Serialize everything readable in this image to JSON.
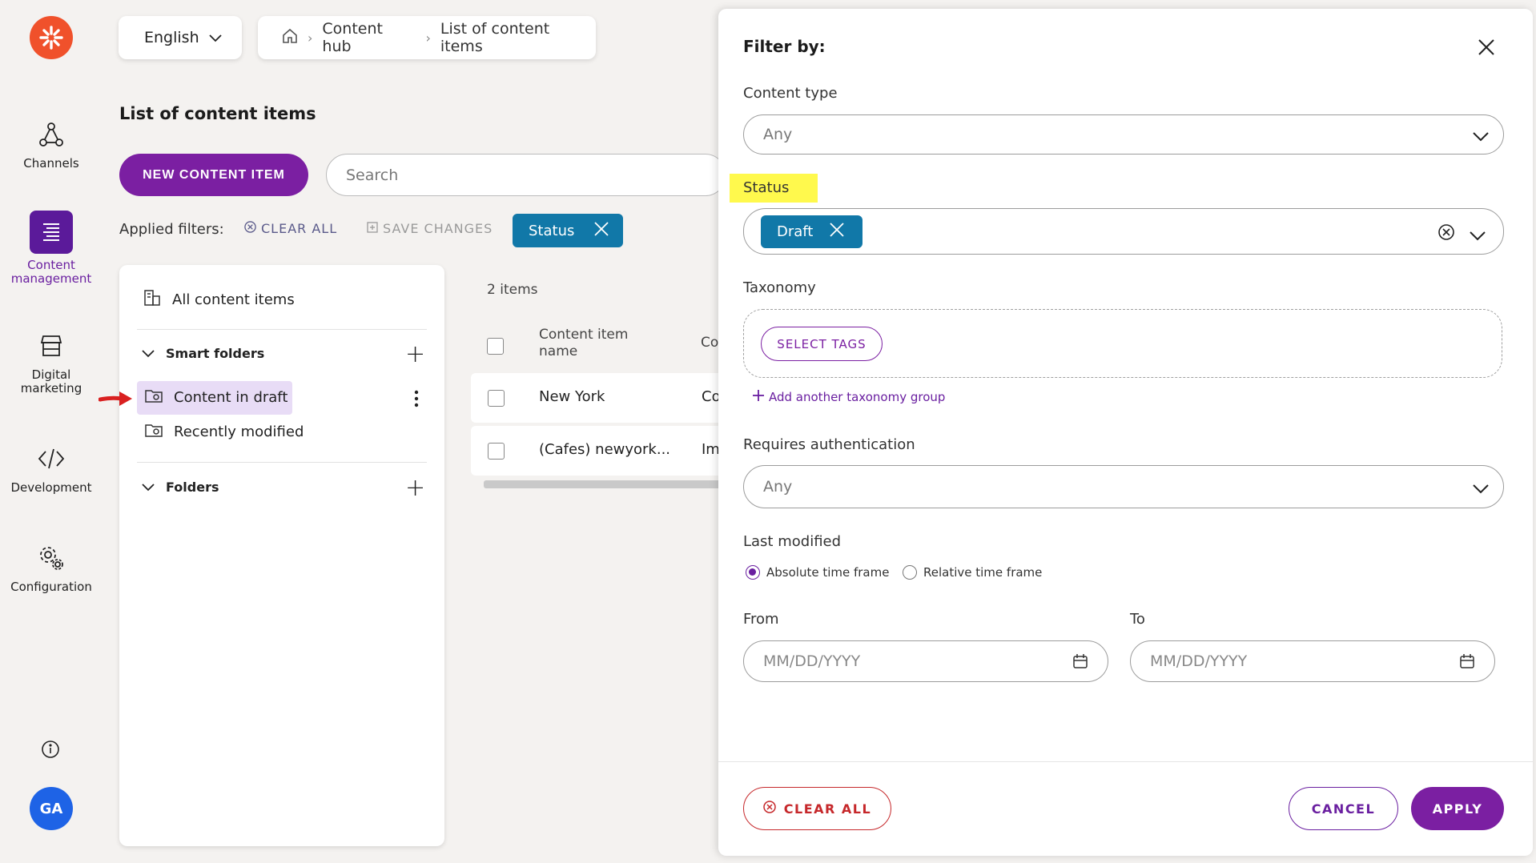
{
  "colors": {
    "brand": "#f0512b",
    "primary": "#7b1fa2",
    "chip": "#1178a8",
    "danger": "#c6282b",
    "highlight": "#fff94d",
    "avatar": "#1e63e6"
  },
  "nav": {
    "logo_icon": "asterisk-logo-icon",
    "items": [
      {
        "label": "Channels",
        "icon": "channels-icon"
      },
      {
        "label": "Content management",
        "icon": "content-management-icon"
      },
      {
        "label": "Digital marketing",
        "icon": "storefront-icon"
      },
      {
        "label": "Development",
        "icon": "code-icon"
      },
      {
        "label": "Configuration",
        "icon": "gear-icon"
      }
    ],
    "info_icon": "info-icon",
    "avatar_initials": "GA"
  },
  "topbar": {
    "language": "English",
    "breadcrumb": [
      "Content hub",
      "List of content items"
    ]
  },
  "main": {
    "title": "List of content items",
    "new_button": "NEW CONTENT ITEM",
    "search_placeholder": "Search",
    "applied_filters_label": "Applied filters:",
    "clear_all": "CLEAR ALL",
    "save_changes": "SAVE CHANGES",
    "status_chip": "Status"
  },
  "folders": {
    "all_items": "All content items",
    "smart_folders_label": "Smart folders",
    "smart_folders": [
      "Content in draft",
      "Recently modified"
    ],
    "folders_label": "Folders"
  },
  "list": {
    "count": "2 items",
    "header_name": "Content item name",
    "header_second": "Co",
    "rows": [
      {
        "name": "New York",
        "second": "Co"
      },
      {
        "name": "(Cafes) newyork...",
        "second": "Im"
      }
    ]
  },
  "filter": {
    "title": "Filter by:",
    "content_type_label": "Content type",
    "content_type_value": "Any",
    "status_label": "Status",
    "status_chip": "Draft",
    "taxonomy_label": "Taxonomy",
    "select_tags": "SELECT TAGS",
    "add_taxonomy": "Add another taxonomy group",
    "requires_auth_label": "Requires authentication",
    "requires_auth_value": "Any",
    "last_modified_label": "Last modified",
    "radio_absolute": "Absolute time frame",
    "radio_relative": "Relative time frame",
    "from_label": "From",
    "to_label": "To",
    "date_placeholder": "MM/DD/YYYY",
    "clear_all": "CLEAR ALL",
    "cancel": "CANCEL",
    "apply": "APPLY"
  }
}
